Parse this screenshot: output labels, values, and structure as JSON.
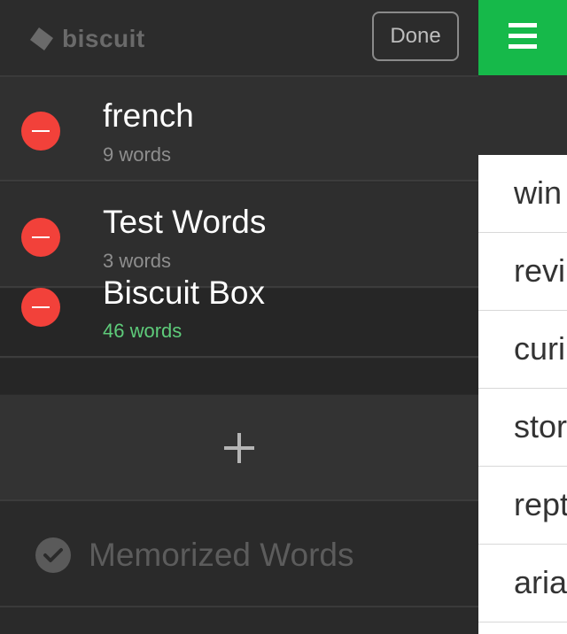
{
  "header": {
    "logo_text": "biscuit",
    "done_label": "Done"
  },
  "decks": [
    {
      "name": "french",
      "count": "9 words",
      "active": false
    },
    {
      "name": "Test Words",
      "count": "3 words",
      "active": false
    },
    {
      "name": "Biscuit Box",
      "count": "46 words",
      "active": true
    }
  ],
  "add_deck": {
    "icon": "plus-icon"
  },
  "memorized": {
    "label": "Memorized Words",
    "icon": "checkmark-circle-icon"
  },
  "main": {
    "menu_icon": "hamburger-menu-icon",
    "words": [
      "win",
      "revi",
      "curi",
      "stor",
      "rept",
      "aria"
    ]
  },
  "colors": {
    "accent_green": "#16b94a",
    "delete_red": "#f2413a",
    "active_count_green": "#5ecb7a"
  }
}
